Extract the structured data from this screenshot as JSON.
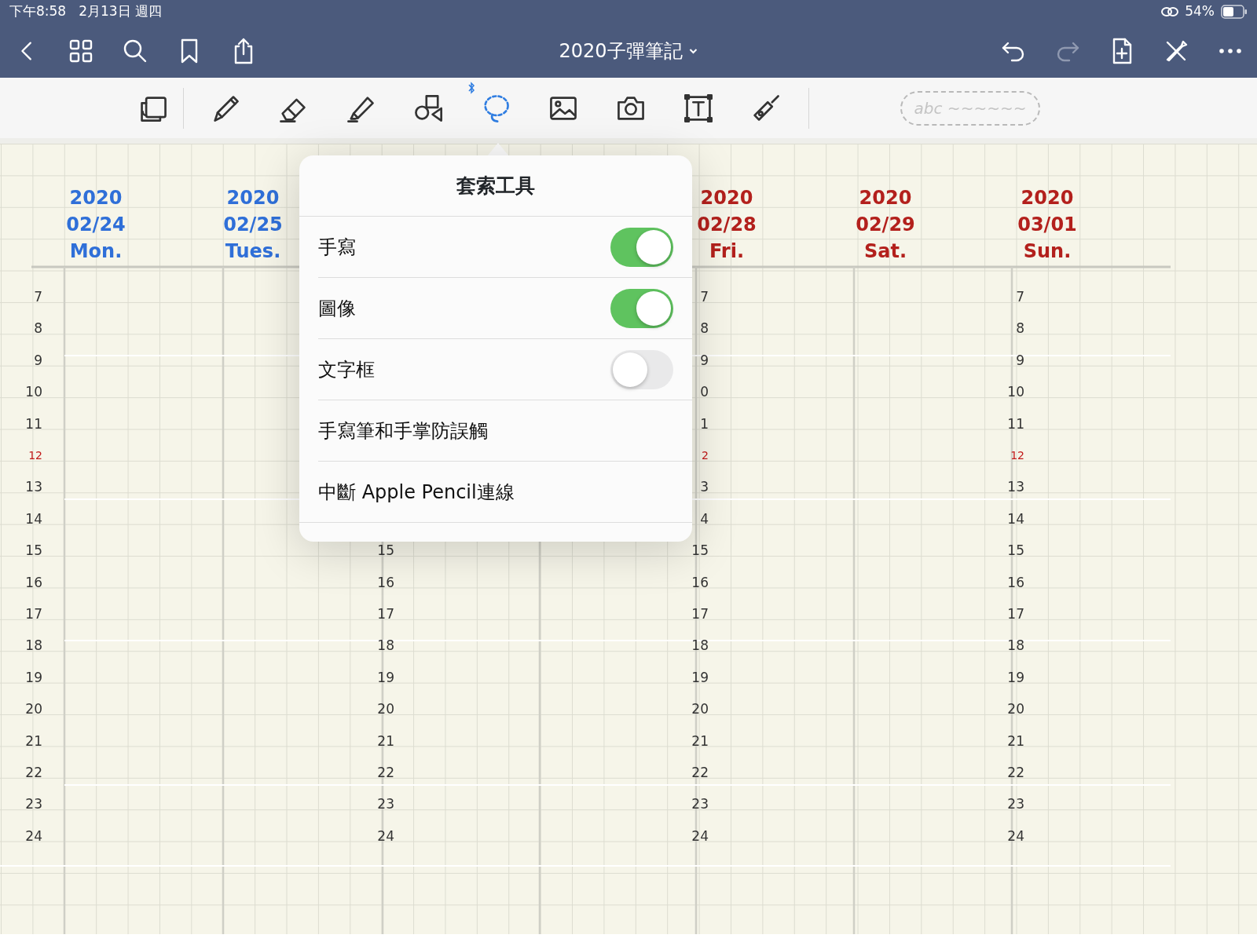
{
  "status_bar": {
    "time": "下午8:58",
    "date": "2月13日 週四",
    "battery": "54%"
  },
  "nav": {
    "title": "2020子彈筆記",
    "redo_disabled": true
  },
  "toolbar": {
    "tools": [
      {
        "kind": "pages",
        "selected": false
      },
      {
        "kind": "pen",
        "selected": false
      },
      {
        "kind": "eraser",
        "selected": false
      },
      {
        "kind": "highlighter",
        "selected": false
      },
      {
        "kind": "shapes",
        "selected": false
      },
      {
        "kind": "lasso",
        "selected": true
      },
      {
        "kind": "image",
        "selected": false
      },
      {
        "kind": "camera",
        "selected": false
      },
      {
        "kind": "textbox",
        "selected": false
      },
      {
        "kind": "laser",
        "selected": false
      }
    ],
    "pen_preview": "abc ~~~~~~"
  },
  "page": {
    "days": [
      {
        "year": "2020",
        "date": "02/24",
        "weekday": "Mon.",
        "color": "#2f6fd8"
      },
      {
        "year": "2020",
        "date": "02/25",
        "weekday": "Tues.",
        "color": "#2f6fd8"
      },
      {
        "year": "2020",
        "date": "02/28",
        "weekday": "Fri.",
        "color": "#b3201c"
      },
      {
        "year": "2020",
        "date": "02/29",
        "weekday": "Sat.",
        "color": "#b3201c"
      },
      {
        "year": "2020",
        "date": "03/01",
        "weekday": "Sun.",
        "color": "#b3201c"
      }
    ],
    "hour_columns": [
      {
        "hours": [
          {
            "label": "7",
            "red": false
          },
          {
            "label": "8",
            "red": false
          },
          {
            "label": "9",
            "red": false
          },
          {
            "label": "10",
            "red": false
          },
          {
            "label": "11",
            "red": false
          },
          {
            "label": "12",
            "red": true
          },
          {
            "label": "13",
            "red": false
          },
          {
            "label": "14",
            "red": false
          },
          {
            "label": "15",
            "red": false
          },
          {
            "label": "16",
            "red": false
          },
          {
            "label": "17",
            "red": false
          },
          {
            "label": "18",
            "red": false
          },
          {
            "label": "19",
            "red": false
          },
          {
            "label": "20",
            "red": false
          },
          {
            "label": "21",
            "red": false
          },
          {
            "label": "22",
            "red": false
          },
          {
            "label": "23",
            "red": false
          },
          {
            "label": "24",
            "red": false
          }
        ]
      },
      {
        "hours": [
          {
            "label": "15",
            "red": false
          },
          {
            "label": "16",
            "red": false
          },
          {
            "label": "17",
            "red": false
          },
          {
            "label": "18",
            "red": false
          },
          {
            "label": "19",
            "red": false
          },
          {
            "label": "20",
            "red": false
          },
          {
            "label": "21",
            "red": false
          },
          {
            "label": "22",
            "red": false
          },
          {
            "label": "23",
            "red": false
          },
          {
            "label": "24",
            "red": false
          }
        ]
      },
      {
        "hours": [
          {
            "label": "7",
            "red": false
          },
          {
            "label": "8",
            "red": false
          },
          {
            "label": "9",
            "red": false
          },
          {
            "label": "0",
            "red": false
          },
          {
            "label": "1",
            "red": false
          },
          {
            "label": "2",
            "red": true
          },
          {
            "label": "3",
            "red": false
          },
          {
            "label": "4",
            "red": false
          },
          {
            "label": "15",
            "red": false
          },
          {
            "label": "16",
            "red": false
          },
          {
            "label": "17",
            "red": false
          },
          {
            "label": "18",
            "red": false
          },
          {
            "label": "19",
            "red": false
          },
          {
            "label": "20",
            "red": false
          },
          {
            "label": "21",
            "red": false
          },
          {
            "label": "22",
            "red": false
          },
          {
            "label": "23",
            "red": false
          },
          {
            "label": "24",
            "red": false
          }
        ]
      },
      {
        "hours": [
          {
            "label": "7",
            "red": false
          },
          {
            "label": "8",
            "red": false
          },
          {
            "label": "9",
            "red": false
          },
          {
            "label": "10",
            "red": false
          },
          {
            "label": "11",
            "red": false
          },
          {
            "label": "12",
            "red": true
          },
          {
            "label": "13",
            "red": false
          },
          {
            "label": "14",
            "red": false
          },
          {
            "label": "15",
            "red": false
          },
          {
            "label": "16",
            "red": false
          },
          {
            "label": "17",
            "red": false
          },
          {
            "label": "18",
            "red": false
          },
          {
            "label": "19",
            "red": false
          },
          {
            "label": "20",
            "red": false
          },
          {
            "label": "21",
            "red": false
          },
          {
            "label": "22",
            "red": false
          },
          {
            "label": "23",
            "red": false
          },
          {
            "label": "24",
            "red": false
          }
        ]
      }
    ]
  },
  "popover": {
    "title": "套索工具",
    "items": [
      {
        "kind": "toggle",
        "label": "手寫",
        "on": true
      },
      {
        "kind": "toggle",
        "label": "圖像",
        "on": true
      },
      {
        "kind": "toggle",
        "label": "文字框",
        "on": false
      },
      {
        "kind": "action",
        "label": "手寫筆和手掌防誤觸"
      },
      {
        "kind": "action",
        "label": "中斷 Apple Pencil連線"
      }
    ]
  }
}
